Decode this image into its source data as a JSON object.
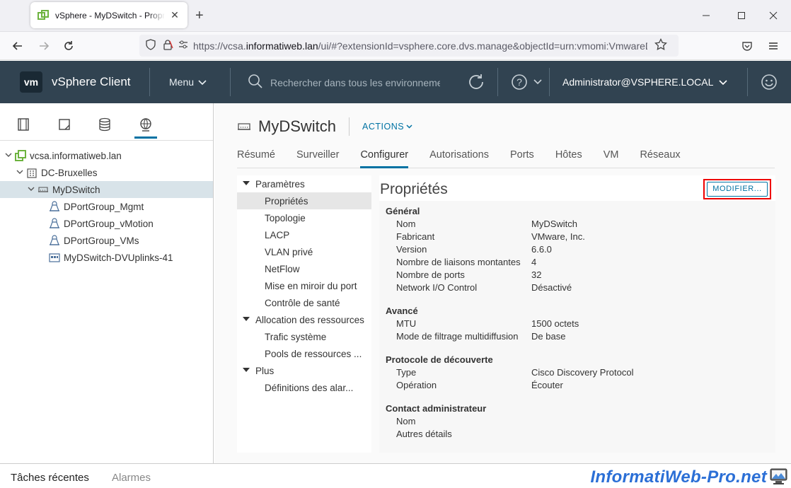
{
  "browser": {
    "tab_title": "vSphere - MyDSwitch - Propriét",
    "new_tab_symbol": "+",
    "url_prefix": "https://vcsa.",
    "url_domain": "informatiweb.lan",
    "url_rest": "/ui/#?extensionId=vsphere.core.dvs.manage&objectId=urn:vmomi:VmwareD"
  },
  "header": {
    "logo": "vm",
    "title": "vSphere Client",
    "menu_label": "Menu",
    "search_placeholder": "Rechercher dans tous les environnements",
    "user": "Administrator@VSPHERE.LOCAL"
  },
  "tree": [
    {
      "label": "vcsa.informatiweb.lan",
      "level": 0,
      "icon": "vcenter-icon",
      "expanded": true
    },
    {
      "label": "DC-Bruxelles",
      "level": 1,
      "icon": "datacenter-icon",
      "expanded": true
    },
    {
      "label": "MyDSwitch",
      "level": 2,
      "icon": "dswitch-icon",
      "expanded": true,
      "selected": true
    },
    {
      "label": "DPortGroup_Mgmt",
      "level": 3,
      "icon": "portgroup-icon"
    },
    {
      "label": "DPortGroup_vMotion",
      "level": 3,
      "icon": "portgroup-icon"
    },
    {
      "label": "DPortGroup_VMs",
      "level": 3,
      "icon": "portgroup-icon"
    },
    {
      "label": "MyDSwitch-DVUplinks-41",
      "level": 3,
      "icon": "uplinks-icon"
    }
  ],
  "object": {
    "name": "MyDSwitch",
    "actions_label": "ACTIONS"
  },
  "tabs": [
    "Résumé",
    "Surveiller",
    "Configurer",
    "Autorisations",
    "Ports",
    "Hôtes",
    "VM",
    "Réseaux"
  ],
  "active_tab": "Configurer",
  "settings_menu": [
    {
      "label": "Paramètres",
      "type": "group"
    },
    {
      "label": "Propriétés",
      "type": "child",
      "selected": true
    },
    {
      "label": "Topologie",
      "type": "child"
    },
    {
      "label": "LACP",
      "type": "child"
    },
    {
      "label": "VLAN privé",
      "type": "child"
    },
    {
      "label": "NetFlow",
      "type": "child"
    },
    {
      "label": "Mise en miroir du port",
      "type": "child"
    },
    {
      "label": "Contrôle de santé",
      "type": "child"
    },
    {
      "label": "Allocation des ressources",
      "type": "group"
    },
    {
      "label": "Trafic système",
      "type": "child"
    },
    {
      "label": "Pools de ressources ...",
      "type": "child"
    },
    {
      "label": "Plus",
      "type": "group"
    },
    {
      "label": "Définitions des alar...",
      "type": "child"
    }
  ],
  "panel": {
    "title": "Propriétés",
    "edit_label": "MODIFIER...",
    "sections": [
      {
        "title": "Général",
        "rows": [
          {
            "k": "Nom",
            "v": "MyDSwitch"
          },
          {
            "k": "Fabricant",
            "v": "VMware, Inc."
          },
          {
            "k": "Version",
            "v": "6.6.0"
          },
          {
            "k": "Nombre de liaisons montantes",
            "v": "4"
          },
          {
            "k": "Nombre de ports",
            "v": "32"
          },
          {
            "k": "Network I/O Control",
            "v": "Désactivé"
          }
        ]
      },
      {
        "title": "Avancé",
        "rows": [
          {
            "k": "MTU",
            "v": "1500 octets"
          },
          {
            "k": "Mode de filtrage multidiffusion",
            "v": "De base"
          }
        ]
      },
      {
        "title": "Protocole de découverte",
        "rows": [
          {
            "k": "Type",
            "v": "Cisco Discovery Protocol"
          },
          {
            "k": "Opération",
            "v": "Écouter"
          }
        ]
      },
      {
        "title": "Contact administrateur",
        "rows": [
          {
            "k": "Nom",
            "v": ""
          },
          {
            "k": "Autres détails",
            "v": ""
          }
        ]
      }
    ]
  },
  "bottom": {
    "recent_tasks": "Tâches récentes",
    "alarms": "Alarmes",
    "watermark": "InformatiWeb-Pro.net"
  },
  "colors": {
    "header_bg": "#314351",
    "accent": "#0072a3",
    "highlight": "#e00000"
  }
}
